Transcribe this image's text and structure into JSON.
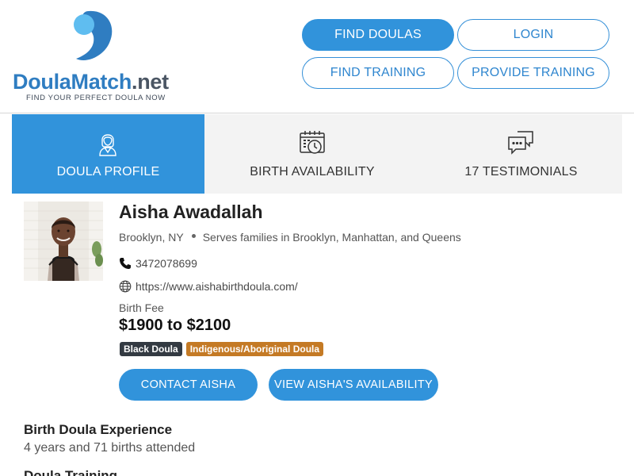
{
  "logo": {
    "brand_main": "DoulaMatch",
    "brand_tld": ".net",
    "tagline": "FIND YOUR PERFECT DOULA NOW"
  },
  "nav": {
    "find_doulas": "FIND DOULAS",
    "login": "LOGIN",
    "find_training": "FIND TRAINING",
    "provide_training": "PROVIDE TRAINING"
  },
  "tabs": [
    {
      "label": "DOULA PROFILE",
      "icon": "doula-person-icon",
      "active": true
    },
    {
      "label": "BIRTH AVAILABILITY",
      "icon": "calendar-clock-icon",
      "active": false
    },
    {
      "label": "17 TESTIMONIALS",
      "icon": "speech-bubbles-icon",
      "active": false
    }
  ],
  "profile": {
    "name": "Aisha Awadallah",
    "location": "Brooklyn, NY",
    "serves": "Serves families in Brooklyn, Manhattan, and Queens",
    "phone": "3472078699",
    "website": "https://www.aishabirthdoula.com/",
    "fee_label": "Birth Fee",
    "fee_value": "$1900 to $2100",
    "badges": [
      {
        "label": "Black Doula",
        "color": "#333a42"
      },
      {
        "label": "Indigenous/Aboriginal Doula",
        "color": "#c47a25"
      }
    ],
    "contact_button": "CONTACT AISHA",
    "availability_button": "VIEW AISHA'S AVAILABILITY"
  },
  "sections": {
    "experience_title": "Birth Doula Experience",
    "experience_body": "4 years and 71 births attended",
    "training_title": "Doula Training"
  },
  "colors": {
    "accent": "#3193db",
    "logo_blue": "#2f7dc1",
    "logo_light_blue": "#5fbdf0"
  }
}
